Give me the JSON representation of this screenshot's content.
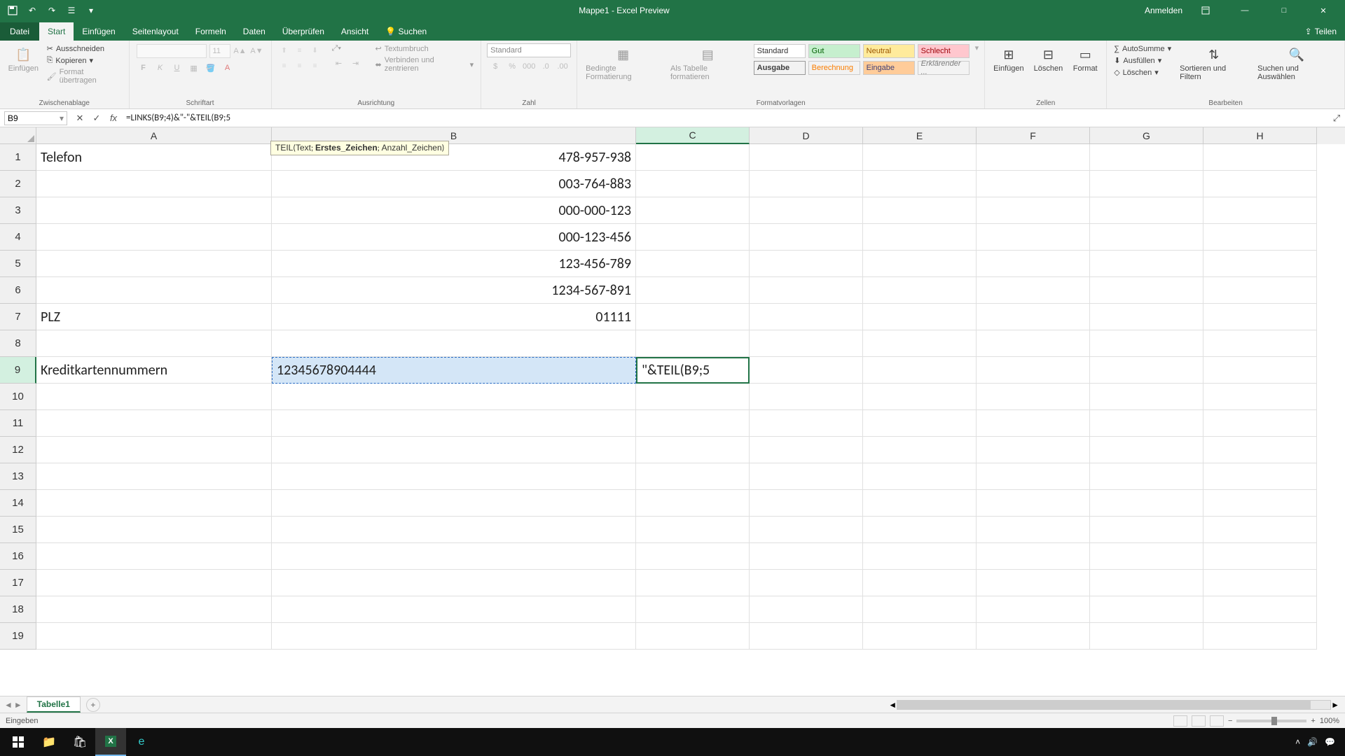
{
  "titlebar": {
    "title": "Mappe1 - Excel Preview",
    "signin": "Anmelden"
  },
  "tabs": {
    "file": "Datei",
    "home": "Start",
    "insert": "Einfügen",
    "layout": "Seitenlayout",
    "formulas": "Formeln",
    "data": "Daten",
    "review": "Überprüfen",
    "view": "Ansicht",
    "search": "Suchen",
    "share": "Teilen"
  },
  "ribbon": {
    "clipboard": {
      "paste": "Einfügen",
      "cut": "Ausschneiden",
      "copy": "Kopieren",
      "format": "Format übertragen",
      "label": "Zwischenablage"
    },
    "font": {
      "size": "11",
      "label": "Schriftart"
    },
    "align": {
      "wrap": "Textumbruch",
      "merge": "Verbinden und zentrieren",
      "label": "Ausrichtung"
    },
    "number": {
      "format": "Standard",
      "label": "Zahl"
    },
    "styles": {
      "cond": "Bedingte Formatierung",
      "table": "Als Tabelle formatieren",
      "standard": "Standard",
      "gut": "Gut",
      "neutral": "Neutral",
      "schlecht": "Schlecht",
      "ausgabe": "Ausgabe",
      "berechnung": "Berechnung",
      "eingabe": "Eingabe",
      "erkl": "Erklärender ...",
      "label": "Formatvorlagen"
    },
    "cells": {
      "insert": "Einfügen",
      "delete": "Löschen",
      "format": "Format",
      "label": "Zellen"
    },
    "editing": {
      "sum": "AutoSumme",
      "fill": "Ausfüllen",
      "clear": "Löschen",
      "sort": "Sortieren und Filtern",
      "find": "Suchen und Auswählen",
      "label": "Bearbeiten"
    }
  },
  "formula": {
    "namebox": "B9",
    "content": "=LINKS(B9;4)&\"-\"&TEIL(B9;5"
  },
  "tooltip": {
    "fn": "TEIL",
    "p1": "Text",
    "p2": "Erstes_Zeichen",
    "p3": "Anzahl_Zeichen"
  },
  "cells": {
    "A1": "Telefon",
    "B1": "478-957-938",
    "B2": "003-764-883",
    "B3": "000-000-123",
    "B4": "000-123-456",
    "B5": "123-456-789",
    "B6": "1234-567-891",
    "A7": "PLZ",
    "B7": "01111",
    "A9": "Kreditkartennummern",
    "B9": "12345678904444",
    "C9": "\"&TEIL(B9;5"
  },
  "sheets": {
    "tab1": "Tabelle1"
  },
  "status": {
    "mode": "Eingeben",
    "zoom": "100%"
  },
  "taskbar": {
    "time": ""
  }
}
